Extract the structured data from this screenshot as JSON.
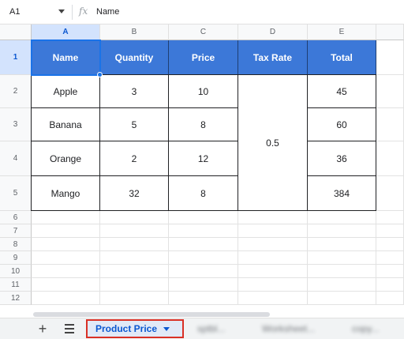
{
  "formula_bar": {
    "cell_ref": "A1",
    "fx_label": "fx",
    "value": "Name"
  },
  "columns": [
    "A",
    "B",
    "C",
    "D",
    "E"
  ],
  "rows": [
    "1",
    "2",
    "3",
    "4",
    "5",
    "6",
    "7",
    "8",
    "9",
    "10",
    "11",
    "12"
  ],
  "selected_cell": "A1",
  "table": {
    "headers": [
      "Name",
      "Quantity",
      "Price",
      "Tax Rate",
      "Total"
    ],
    "rows": [
      [
        "Apple",
        "3",
        "10",
        "45"
      ],
      [
        "Banana",
        "5",
        "8",
        "60"
      ],
      [
        "Orange",
        "2",
        "12",
        "36"
      ],
      [
        "Mango",
        "32",
        "8",
        "384"
      ]
    ],
    "tax_rate_merged": "0.5"
  },
  "colors": {
    "header_fill": "#3c78d8",
    "selection": "#1a73e8",
    "active_tab_outline": "#d93025"
  },
  "sheet_tabs": {
    "add_icon": "plus-icon",
    "menu_icon": "hamburger-icon",
    "active": "Product Price",
    "others": [
      "sptbl...",
      "Worksheet...",
      "copy..."
    ]
  }
}
